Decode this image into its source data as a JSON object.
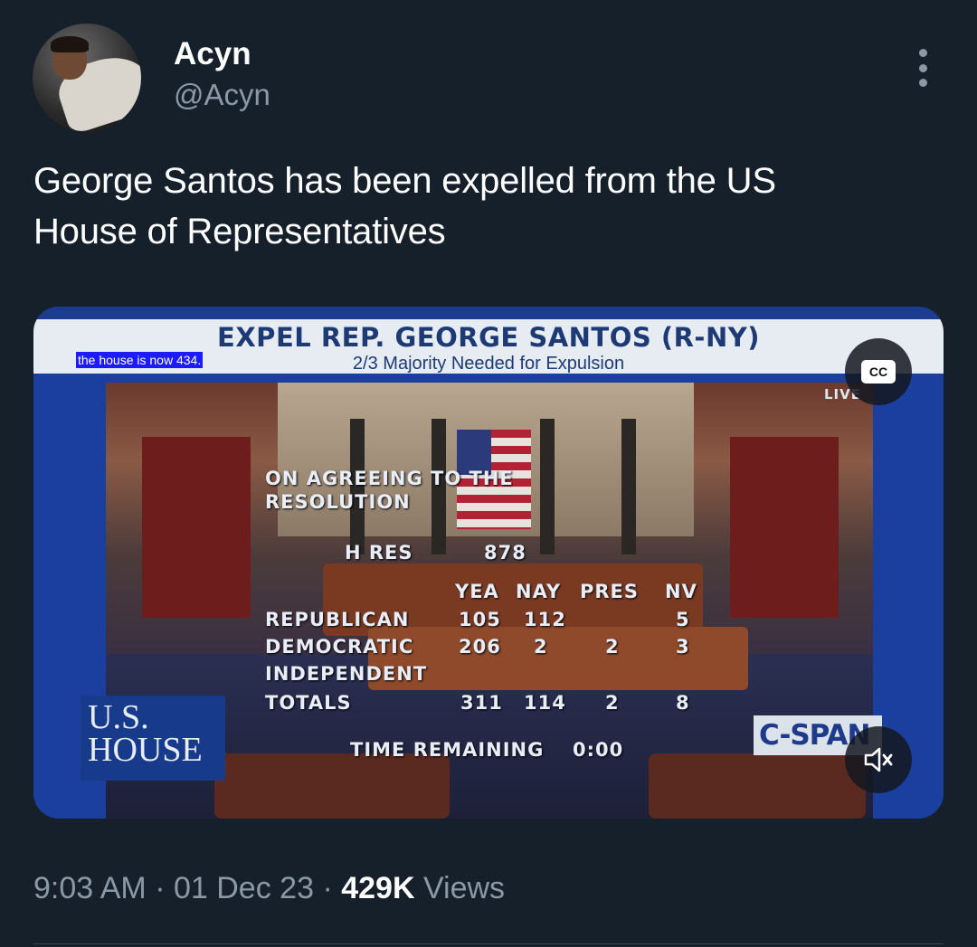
{
  "author": {
    "display_name": "Acyn",
    "handle": "@Acyn"
  },
  "tweet": {
    "text_line1": "George Santos has been expelled from the US",
    "text_line2": "House of Representatives"
  },
  "media": {
    "banner_title": "EXPEL REP. GEORGE SANTOS (R-NY)",
    "banner_subtitle": "2/3 Majority Needed for Expulsion",
    "closed_caption": "the house is now 434.",
    "live_label": "LIVE",
    "cc_label": "CC",
    "vote": {
      "heading_line1": "ON AGREEING TO THE",
      "heading_line2": "RESOLUTION",
      "measure_label": "H RES",
      "measure_number": "878",
      "columns": [
        "YEA",
        "NAY",
        "PRES",
        "NV"
      ],
      "rows": [
        {
          "party": "REPUBLICAN",
          "yea": "105",
          "nay": "112",
          "pres": "",
          "nv": "5"
        },
        {
          "party": "DEMOCRATIC",
          "yea": "206",
          "nay": "2",
          "pres": "2",
          "nv": "3"
        },
        {
          "party": "INDEPENDENT",
          "yea": "",
          "nay": "",
          "pres": "",
          "nv": ""
        },
        {
          "party": "TOTALS",
          "yea": "311",
          "nay": "114",
          "pres": "2",
          "nv": "8"
        }
      ],
      "time_label": "TIME REMAINING",
      "time_value": "0:00"
    },
    "network_logo_line1": "U.S.",
    "network_logo_line2": "HOUSE",
    "broadcaster_logo": "C-SPAN",
    "mute_icon": "speaker-muted-icon",
    "accent_color": "#1d9bf0"
  },
  "meta": {
    "time": "9:03 AM",
    "separator": "·",
    "date": "01 Dec 23",
    "views_count": "429K",
    "views_label": "Views"
  }
}
